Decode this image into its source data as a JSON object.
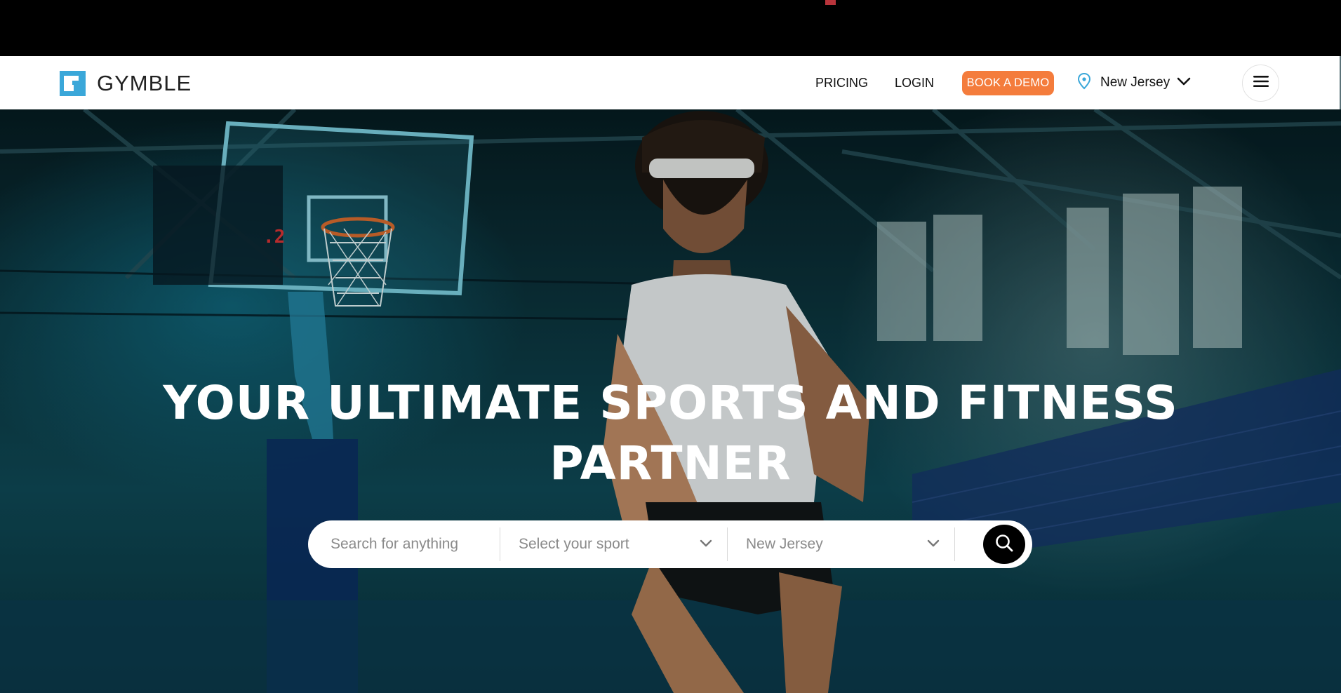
{
  "header": {
    "logo_text": "GYMBLE",
    "nav": [
      {
        "label": "PRICING"
      },
      {
        "label": "LOGIN"
      }
    ],
    "demo_button": "BOOK A DEMO",
    "location": "New Jersey"
  },
  "hero": {
    "headline_line1": "YOUR ULTIMATE SPORTS AND FITNESS",
    "headline_line2": "PARTNER"
  },
  "search": {
    "query_placeholder": "Search for anything",
    "sport_placeholder": "Select your sport",
    "location_value": "New Jersey"
  },
  "colors": {
    "accent": "#f47c3c",
    "logo_blue": "#3aa7d9",
    "location_pin": "#3aa7d9"
  },
  "icons": {
    "logo": "gymble-logo-icon",
    "location": "map-pin-icon",
    "dropdown": "chevron-down-icon",
    "menu": "hamburger-menu-icon",
    "search": "search-icon"
  }
}
